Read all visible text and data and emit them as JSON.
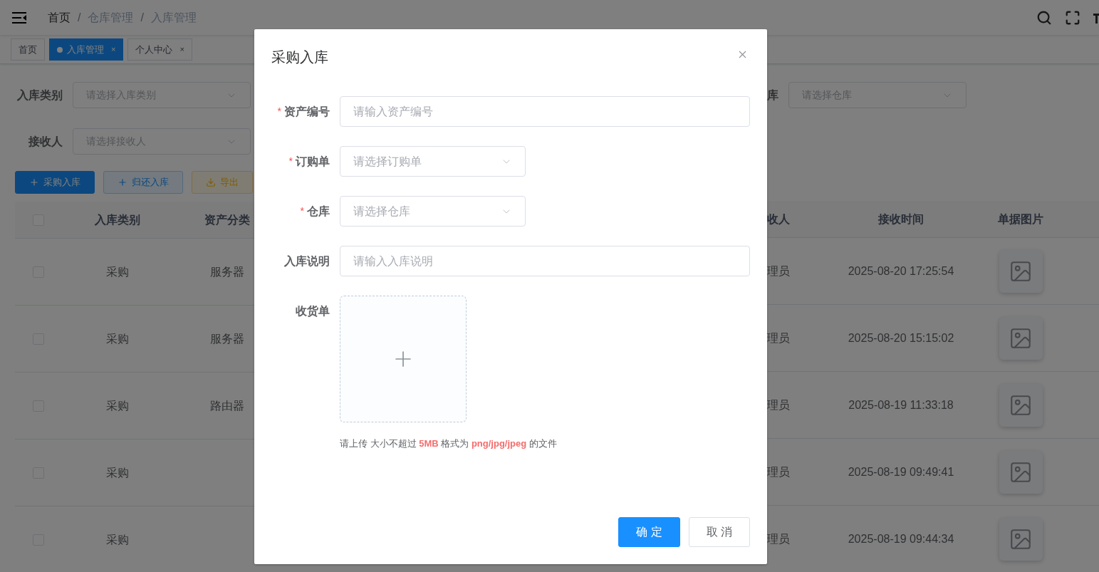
{
  "header": {
    "breadcrumb": [
      "首页",
      "仓库管理",
      "入库管理"
    ],
    "separator": "/"
  },
  "tags": [
    {
      "label": "首页",
      "selected": false,
      "closable": false
    },
    {
      "label": "入库管理",
      "selected": true,
      "closable": true
    },
    {
      "label": "个人中心",
      "selected": false,
      "closable": true
    }
  ],
  "tag_close": "×",
  "filters_left": [
    {
      "label": "入库类别",
      "placeholder": "请选择入库类别"
    },
    {
      "label": "接收人",
      "placeholder": "请选择接收人"
    }
  ],
  "filters_right": [
    {
      "label": "库",
      "placeholder": "请选择仓库"
    }
  ],
  "toolbar": [
    {
      "label": "采购入库",
      "kind": "primary"
    },
    {
      "label": "归还入库",
      "kind": "info"
    },
    {
      "label": "导出",
      "kind": "warning"
    }
  ],
  "table": {
    "header_checked": false,
    "columns_left": [
      "入库类别",
      "资产分类"
    ],
    "columns_right": [
      "收人",
      "接收时间",
      "单据图片"
    ],
    "rows": [
      {
        "checked": false,
        "type": "采购",
        "category": "服务器",
        "receiver": "理员",
        "time": "2025-08-20 17:25:54"
      },
      {
        "checked": false,
        "type": "采购",
        "category": "服务器",
        "receiver": "理员",
        "time": "2025-08-20 15:15:02"
      },
      {
        "checked": false,
        "type": "采购",
        "category": "路由器",
        "receiver": "理员",
        "time": "2025-08-19 11:33:18"
      },
      {
        "checked": false,
        "type": "采购",
        "receiver": "理员",
        "time": "2025-08-19 09:49:41"
      },
      {
        "checked": false,
        "type": "采购",
        "receiver": "理员",
        "time": "2025-08-19 09:44:34"
      }
    ]
  },
  "dialog": {
    "title": "采购入库",
    "fields": [
      {
        "label": "资产编号",
        "required": true,
        "kind": "input",
        "placeholder": "请输入资产编号"
      },
      {
        "label": "订购单",
        "required": true,
        "kind": "select",
        "placeholder": "请选择订购单"
      },
      {
        "label": "仓库",
        "required": true,
        "kind": "select",
        "placeholder": "请选择仓库"
      },
      {
        "label": "入库说明",
        "required": false,
        "kind": "input",
        "placeholder": "请输入入库说明"
      },
      {
        "label": "收货单",
        "required": false,
        "kind": "upload"
      }
    ],
    "required_mark": "*",
    "upload_tip": "请上传 大小不超过 **5MB** 格式为 **png/jpg/jpeg** 的文件",
    "buttons": [
      {
        "label": "确 定",
        "kind": "primary"
      },
      {
        "label": "取 消",
        "kind": "default"
      }
    ]
  }
}
